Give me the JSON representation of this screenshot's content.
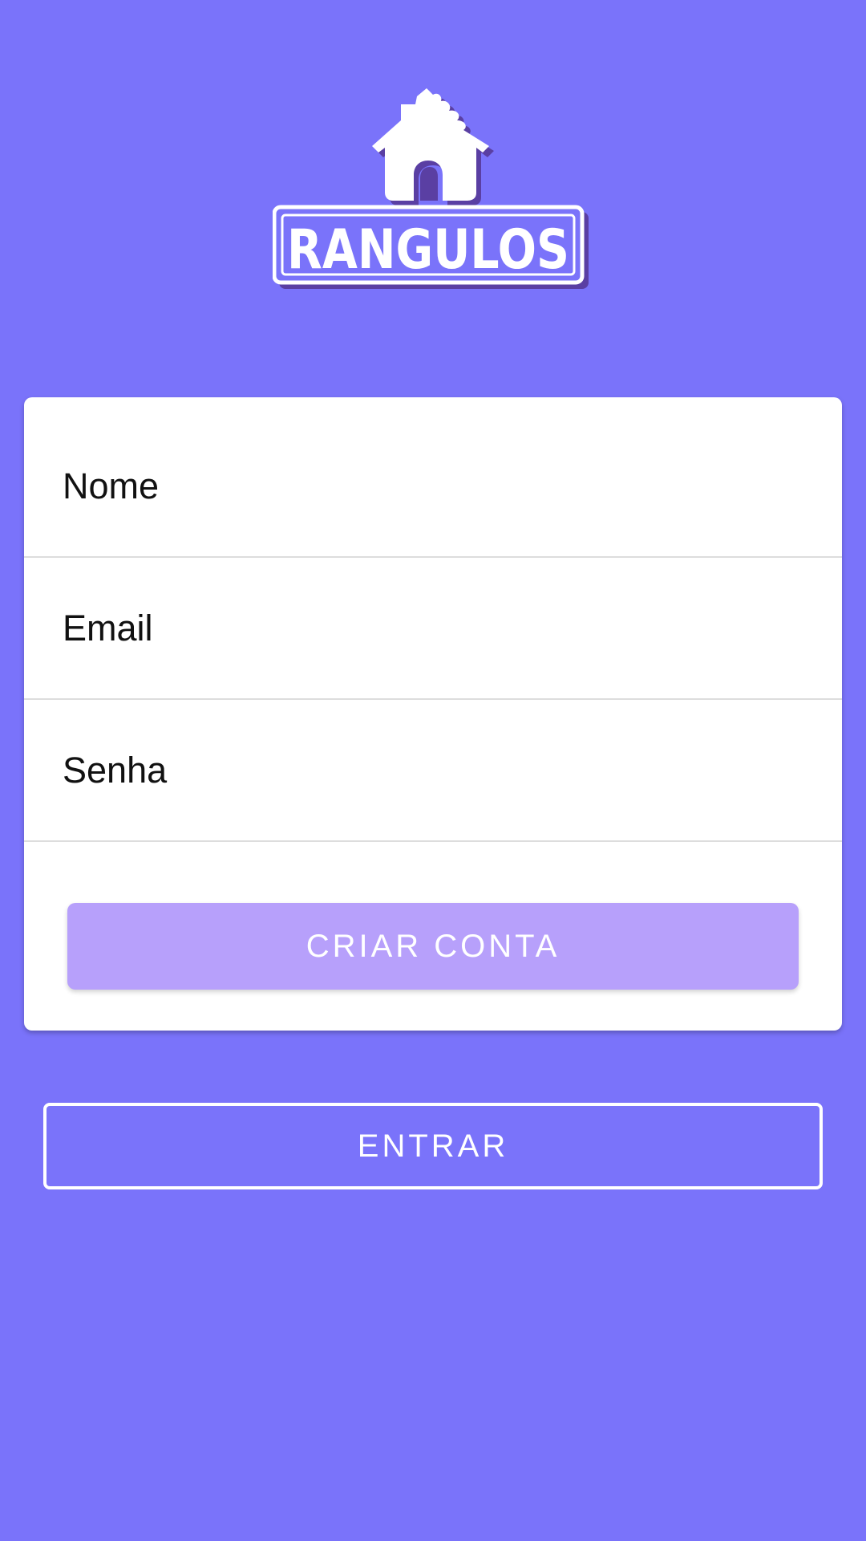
{
  "logo": {
    "text": "RANGULOS",
    "icon": "house-icon",
    "shadow_color": "#5a3fa3",
    "fill_color": "#ffffff"
  },
  "form": {
    "fields": [
      {
        "placeholder": "Nome"
      },
      {
        "placeholder": "Email"
      },
      {
        "placeholder": "Senha"
      }
    ],
    "submit_label": "CRIAR CONTA"
  },
  "login_label": "ENTRAR",
  "colors": {
    "background": "#7a73fa",
    "primary_button": "#b7a0fb",
    "card": "#ffffff"
  }
}
